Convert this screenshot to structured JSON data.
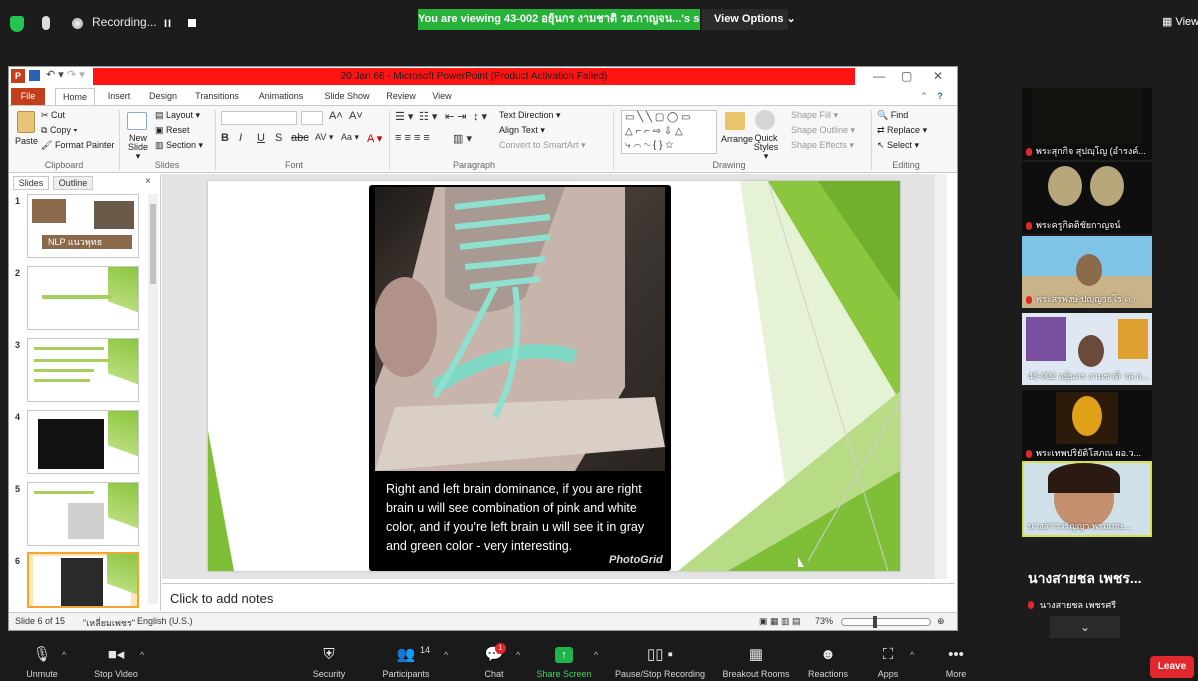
{
  "zoom_top": {
    "recording_label": "Recording...",
    "pause_glyph": "II",
    "share_banner": "You are viewing 43-002 อยุ้นกร งามชาติ วส.กาญจน...'s screen",
    "view_options": "View Options  ⌄",
    "view_toggle": "▦ View"
  },
  "ppt": {
    "logo": "P",
    "title": "20 Jan 66  -  Microsoft PowerPoint (Product Activation Failed)",
    "undo_glyph": "↶ ▾",
    "redo_glyph": "↷ ▾",
    "window_buttons": {
      "minimize": "—",
      "restore": "▢",
      "close": "✕"
    },
    "tabs": [
      "File",
      "Home",
      "Insert",
      "Design",
      "Transitions",
      "Animations",
      "Slide Show",
      "Review",
      "View"
    ],
    "ribbon": {
      "clipboard": {
        "paste": "Paste",
        "cut": "Cut",
        "copy": "Copy ▾",
        "format_painter": "Format Painter",
        "label": "Clipboard"
      },
      "slides": {
        "new_slide": "New Slide ▾",
        "layout": "Layout ▾",
        "reset": "Reset",
        "section": "Section ▾",
        "label": "Slides"
      },
      "font": {
        "label": "Font",
        "bold": "B",
        "italic": "I",
        "underline": "U",
        "strike": "S",
        "abc": "abc",
        "spacing": "AV ▾",
        "case": "Aa ▾",
        "color": "A ▾",
        "grow": "A˄",
        "shrink": "A˅"
      },
      "paragraph": {
        "text_direction": "Text Direction ▾",
        "align_text": "Align Text ▾",
        "convert": "Convert to SmartArt ▾",
        "label": "Paragraph"
      },
      "drawing": {
        "arrange": "Arrange",
        "quick_styles": "Quick Styles ▾",
        "shape_fill": "Shape Fill ▾",
        "shape_outline": "Shape Outline ▾",
        "shape_effects": "Shape Effects ▾",
        "label": "Drawing"
      },
      "editing": {
        "find": "Find",
        "replace": "Replace ▾",
        "select": "Select ▾",
        "label": "Editing"
      }
    },
    "pane_tabs": [
      "Slides",
      "Outline"
    ],
    "pane_close": "×",
    "thumbnails": [
      {
        "num": "1",
        "caption": "NLP แนวพุทธ"
      },
      {
        "num": "2",
        "caption": ""
      },
      {
        "num": "3",
        "caption": ""
      },
      {
        "num": "4",
        "caption": ""
      },
      {
        "num": "5",
        "caption": ""
      },
      {
        "num": "6",
        "caption": ""
      }
    ],
    "slide_caption": "Right and left brain dominance, if you are right brain u will see combination of pink and white color, and if you're left brain u will see it in gray and green color - very interesting.",
    "photogrid": "PhotoGrid",
    "notes_placeholder": "Click to add notes",
    "status": {
      "slide_index": "Slide 6 of 15",
      "theme": "\"เหลี่ยมเพชร\"",
      "language": "English (U.S.)",
      "zoom": "73%"
    }
  },
  "participants": [
    {
      "name": "พระสุกกิจ สุปญฺโญ (อำรงค์..."
    },
    {
      "name": "พระครูกิตติชัยกาญจน์"
    },
    {
      "name": "พระสรพงษ์ ปญฺญาธโร ค..."
    },
    {
      "name": "43-002 อยุ้นกร งามชาติ วส.ก..."
    },
    {
      "name": "พระเทพปริยัติโสภณ ผอ.ว..."
    },
    {
      "name": "นางสาววรัญญา พรมเกษ..."
    }
  ],
  "active_speaker": {
    "name": "นางสายชล  เพชร...",
    "sub": "นางสายชล เพชรศรี",
    "gallery_down": "⌄"
  },
  "toolbar": {
    "unmute": "Unmute",
    "stop_video": "Stop Video",
    "security": "Security",
    "participants": "Participants",
    "participants_count": "14",
    "chat": "Chat",
    "chat_badge": "1",
    "share_screen": "Share Screen",
    "pause_recording": "Pause/Stop Recording",
    "breakout": "Breakout Rooms",
    "reactions": "Reactions",
    "apps": "Apps",
    "more": "More",
    "leave": "Leave",
    "caret": "^"
  },
  "colors": {
    "banner_green": "#27b33a",
    "title_red": "#ff1414",
    "file_tab": "#c43e1c",
    "leave_red": "#e0282d",
    "slide_green": "#8cc63f"
  }
}
